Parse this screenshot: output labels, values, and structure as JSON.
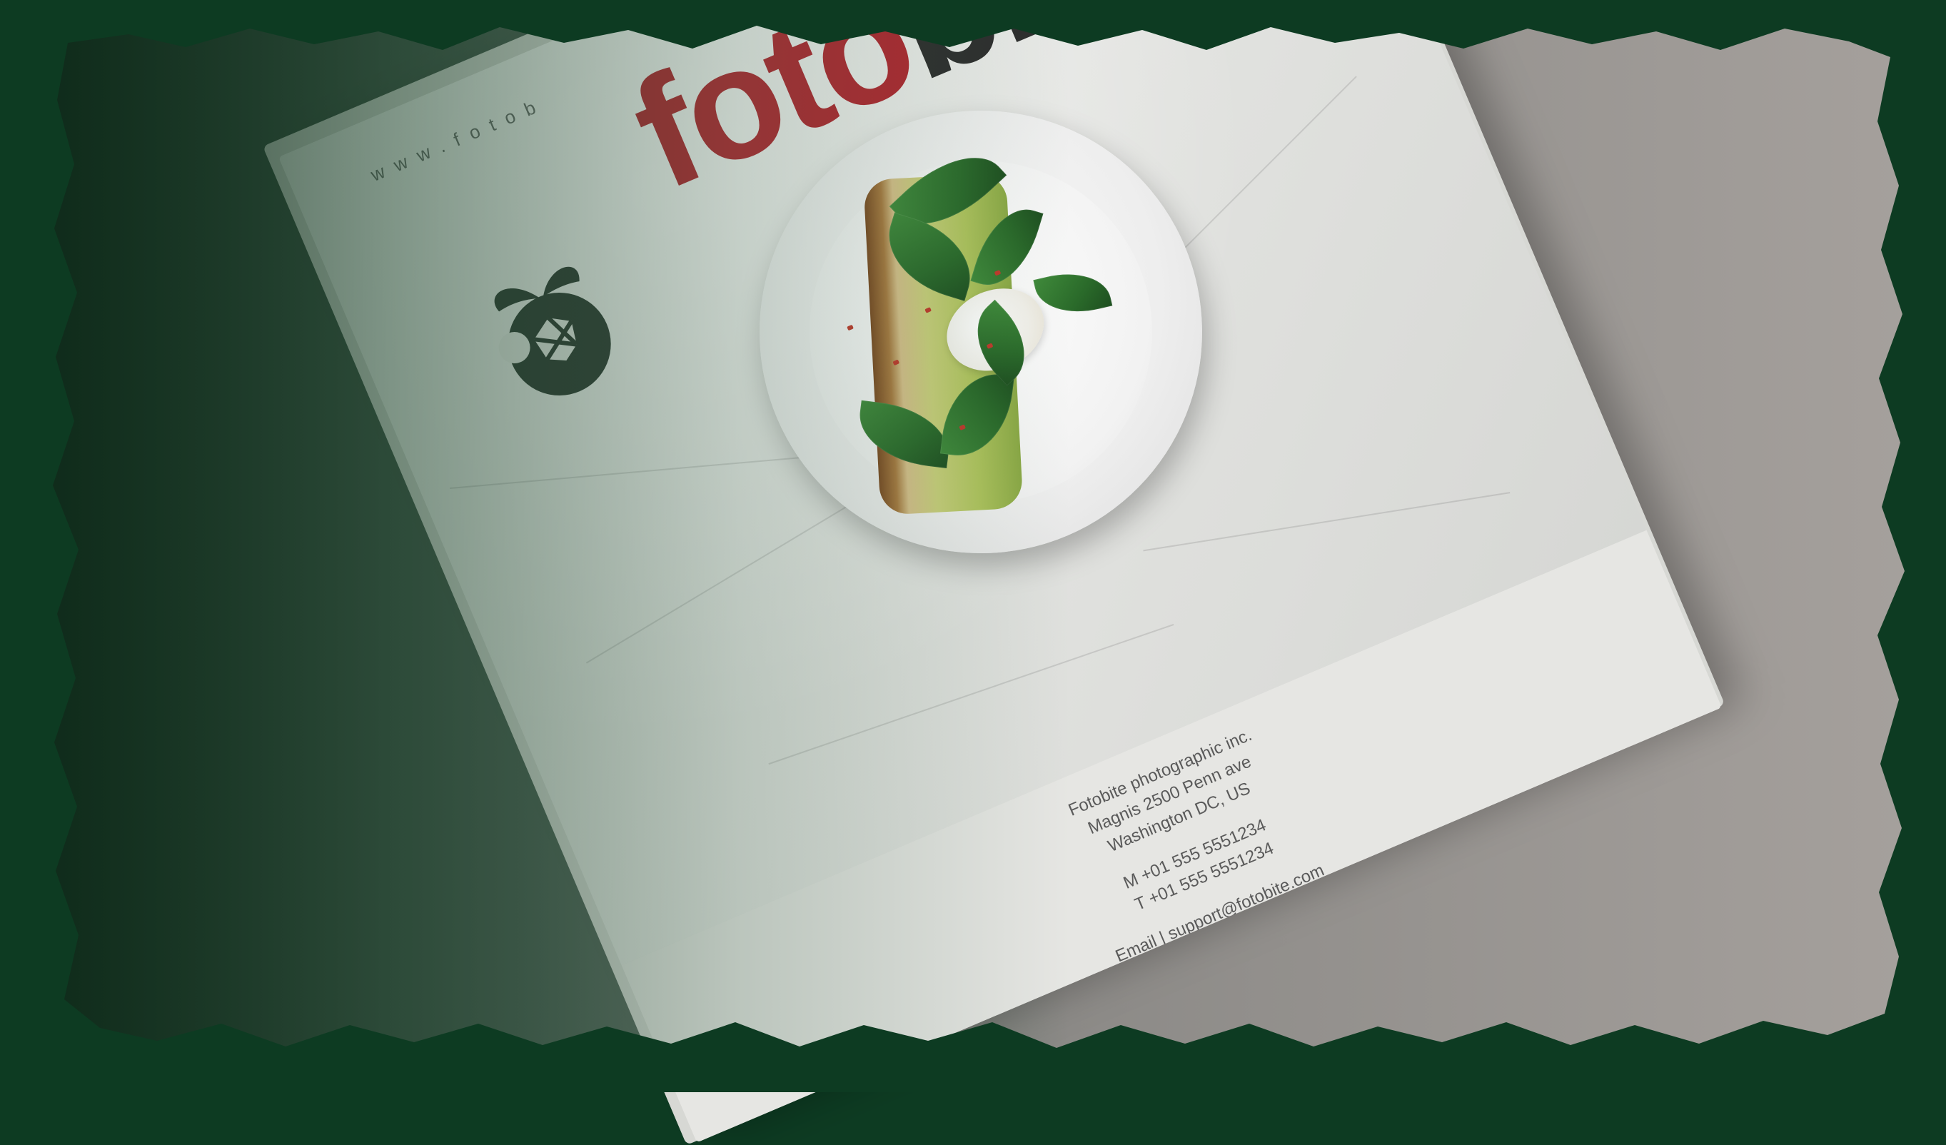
{
  "brand": {
    "url": "www.fotob",
    "name_part1": "foto",
    "name_part2": "bite",
    "accent_color": "#b0262f",
    "dark_color": "#2d2d2d"
  },
  "cover_image": {
    "subject": "avocado toast with poached egg and spinach on a white plate on marble"
  },
  "address": {
    "company": "Fotobite photographic inc.",
    "street": "Magnis 2500 Penn ave",
    "city": "Washington DC, US",
    "mobile": "M +01 555 5551234",
    "phone": "T +01 555 5551234",
    "email": "Email | support@fotobite.com"
  },
  "frame_color": "#0d3b22"
}
